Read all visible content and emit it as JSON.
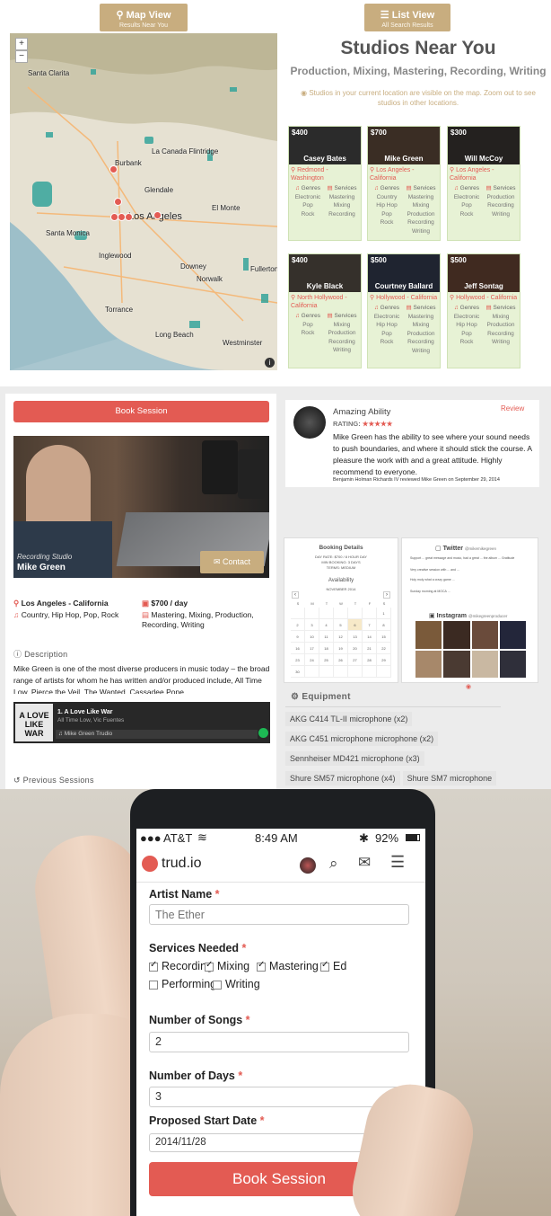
{
  "panel1": {
    "map_tab": {
      "icon": "map-pin-icon",
      "label": "Map View",
      "sub": "Results Near You"
    },
    "list_tab": {
      "icon": "list-icon",
      "label": "List View",
      "sub": "All Search Results"
    },
    "map": {
      "zoom_in": "+",
      "zoom_out": "−",
      "labels": [
        "Santa Clarita",
        "La Canada Flintridge",
        "Burbank",
        "Glendale",
        "El Monte",
        "Los Angeles",
        "Santa Monica",
        "Inglewood",
        "Downey",
        "Norwalk",
        "Torrance",
        "Long Beach",
        "Westminster",
        "Fullerton"
      ],
      "attribution": "i",
      "water_color": "#2aa198"
    },
    "title": "Studios Near You",
    "subtitle": "Production, Mixing, Mastering, Recording, Writing",
    "note": "Studios in your current location are visible on the map. Zoom out to see studios in other locations.",
    "cards": [
      {
        "price": "$400",
        "name": "Casey Bates",
        "location": "Redmond - Washington",
        "genres": [
          "Electronic",
          "Pop",
          "Rock"
        ],
        "services": [
          "Mastering",
          "Mixing",
          "Recording"
        ]
      },
      {
        "price": "$700",
        "name": "Mike Green",
        "location": "Los Angeles - California",
        "genres": [
          "Country",
          "Hip Hop",
          "Pop",
          "Rock"
        ],
        "services": [
          "Mastering",
          "Mixing",
          "Production",
          "Recording",
          "Writing"
        ]
      },
      {
        "price": "$300",
        "name": "Will McCoy",
        "location": "Los Angeles - California",
        "genres": [
          "Electronic",
          "Pop",
          "Rock"
        ],
        "services": [
          "Production",
          "Recording",
          "Writing"
        ]
      },
      {
        "price": "$400",
        "name": "Kyle Black",
        "location": "North Hollywood - California",
        "genres": [
          "Pop",
          "Rock"
        ],
        "services": [
          "Mixing",
          "Production",
          "Recording",
          "Writing"
        ]
      },
      {
        "price": "$500",
        "name": "Courtney Ballard",
        "location": "Hollywood - California",
        "genres": [
          "Electronic",
          "Hip Hop",
          "Pop",
          "Rock"
        ],
        "services": [
          "Mastering",
          "Mixing",
          "Production",
          "Recording",
          "Writing"
        ]
      },
      {
        "price": "$500",
        "name": "Jeff Sontag",
        "location": "Hollywood - California",
        "genres": [
          "Electronic",
          "Hip Hop",
          "Pop",
          "Rock"
        ],
        "services": [
          "Mixing",
          "Production",
          "Recording",
          "Writing"
        ]
      }
    ],
    "genres_head": "Genres",
    "services_head": "Services"
  },
  "panel2": {
    "book_label": "Book Session",
    "studio_caption": "Recording Studio",
    "studio_name": "Mike Green",
    "contact_label": "Contact",
    "location": "Los Angeles - California",
    "price": "$700 / day",
    "genres": "Country, Hip Hop, Pop, Rock",
    "services": "Mastering, Mixing, Production, Recording, Writing",
    "description_head": "Description",
    "description": "Mike Green is one of the most diverse producers in music today – the broad range of artists for whom he has written and/or produced include, All Time Low, Pierce the Veil, The Wanted, Cassadee Pope",
    "player": {
      "album_text": "A LOVE LIKE WAR",
      "track": "1. A Love Like War",
      "artists": "All Time Low, Vic Fuentes",
      "playlist": "Mike Green Trudio"
    },
    "previous_head": "Previous Sessions",
    "review": {
      "title": "Amazing Ability",
      "link": "Review",
      "rating_label": "RATING:",
      "stars": "★★★★★",
      "text": "Mike Green has the ability to see where your sound needs to push boundaries, and where it should stick the course. A pleasure the work with and a great attitude. Highly recommend to everyone.",
      "footer": "Benjamin Holman Richards IV reviewed Mike Green on September 29, 2014"
    },
    "booking": {
      "title": "Booking Details",
      "line1": "DAY RATE: $700 / 8 HOUR DAY",
      "line2": "MIN BOOKING: 3 DAYS",
      "line3": "TERMS: MEDIUM",
      "availability": "Availability",
      "month": "NOVEMBER 2014",
      "weekdays": [
        "S",
        "M",
        "T",
        "W",
        "T",
        "F",
        "S"
      ]
    },
    "twitter": {
      "label": "Twitter",
      "handle": "@mikemikegreen"
    },
    "tweets": [
      "Support ... great message and music, had a great ... the album ... Gratitude",
      "Very creative session with ... and ...",
      "Holy moly what a crazy game ...",
      "Sunday morning at MOCA ..."
    ],
    "instagram": {
      "label": "Instagram",
      "handle": "@mikegreenproducer"
    },
    "equipment_head": "Equipment",
    "equipment": [
      "AKG C414 TL-II microphone (x2)",
      "AKG C451 microphone microphone (x2)",
      "Sennheiser MD421 microphone (x3)",
      "Shure SM57 microphone (x4)",
      "Shure SM7 microphone"
    ]
  },
  "panel3": {
    "status": {
      "carrier": "AT&T",
      "time": "8:49 AM",
      "battery": "92%"
    },
    "logo_text": "trud.io",
    "artist_label": "Artist Name",
    "artist_placeholder": "The Ether",
    "services_label": "Services Needed",
    "service_options": [
      {
        "label": "Recording",
        "checked": true
      },
      {
        "label": "Mixing",
        "checked": true
      },
      {
        "label": "Mastering",
        "checked": true
      },
      {
        "label": "Ed",
        "checked": true
      },
      {
        "label": "Performing",
        "checked": false
      },
      {
        "label": "Writing",
        "checked": false
      }
    ],
    "songs_label": "Number of Songs",
    "songs_value": "2",
    "days_label": "Number of Days",
    "days_value": "3",
    "start_label": "Proposed Start Date",
    "start_value": "2014/11/28",
    "book_label": "Book Session",
    "required_mark": "*",
    "accent": "#e35b53"
  }
}
